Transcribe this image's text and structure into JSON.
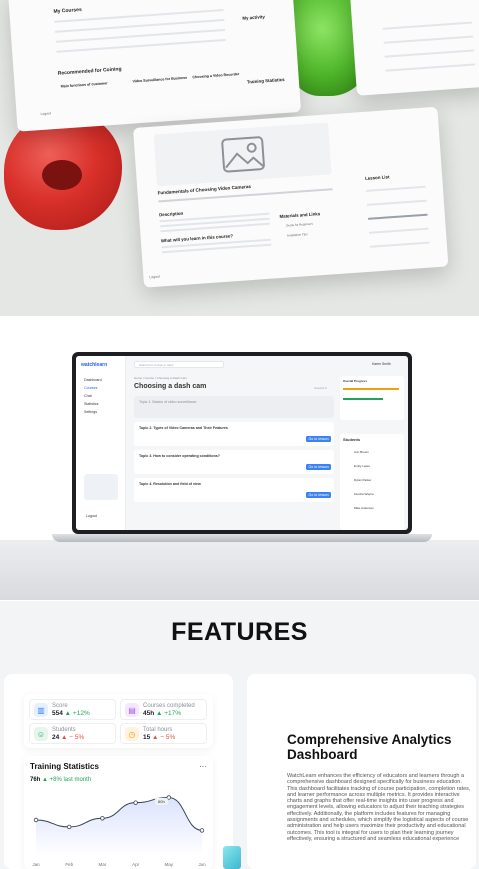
{
  "hero": {
    "dashboard_panel": {
      "my_courses": "My Courses",
      "recommended": "Recommended for Coining",
      "my_activity": "My activity",
      "training_stats": "Training Statistics",
      "course_cards": [
        "Main functions of customer",
        "Video Surveillance for Business",
        "Choosing a Video Recorder"
      ],
      "logout": "Logout"
    },
    "course_panel": {
      "video_title": "Fundamentals of Choosing Video Cameras",
      "description_heading": "Description",
      "learn_heading": "What will you learn in this course?",
      "materials_heading": "Materials and Links",
      "materials": [
        "Guide for Beginners",
        "Installation Tips"
      ],
      "lesson_list": "Lesson List",
      "logout": "Logout"
    }
  },
  "laptop": {
    "logo": "watchlearn",
    "search_placeholder": "Search for course or topic",
    "user_name": "Karen Smith",
    "breadcrumb": "Home / Course / Choosing a Dash Cam",
    "page_title": "Choosing a dash cam",
    "topic_count": "3 out of 4",
    "nav": [
      "Dashboard",
      "Courses",
      "Chat",
      "Statistics",
      "Settings"
    ],
    "topics": [
      {
        "title": "Topic 1. Basics of video surveillance",
        "status": ""
      },
      {
        "title": "Topic 2. Types of Video Cameras and Their Features",
        "status": "Go to lesson"
      },
      {
        "title": "Topic 3. How to consider operating conditions?",
        "status": "Go to lesson"
      },
      {
        "title": "Topic 4. Resolution and field of view",
        "status": "Go to lesson"
      }
    ],
    "progress_heading": "Overall Progress",
    "students_heading": "Students",
    "students": [
      "Ann Brown",
      "Emily Lewis",
      "Dylan Parker",
      "Kendra Wayne",
      "Mike Anderson"
    ],
    "logout": "Logout"
  },
  "features": {
    "title": "FEATURES",
    "stats": [
      {
        "label": "Score",
        "value": "554",
        "delta": "+12%",
        "trend": "up",
        "icon": "chart-icon",
        "color": "#3b82f6"
      },
      {
        "label": "Courses completed",
        "value": "45h",
        "delta": "+17%",
        "trend": "up",
        "icon": "book-icon",
        "color": "#a855f7"
      },
      {
        "label": "Students",
        "value": "24",
        "delta": "− 5%",
        "trend": "down",
        "icon": "user-icon",
        "color": "#22a35a"
      },
      {
        "label": "Total hours",
        "value": "15",
        "delta": "− 5%",
        "trend": "down",
        "icon": "clock-icon",
        "color": "#f59e0b"
      }
    ],
    "training": {
      "title": "Training Statistics",
      "menu": "···",
      "summary_value": "76h",
      "summary_delta": "+8% last month",
      "tooltip": "60h"
    },
    "chart_data": {
      "type": "line",
      "categories": [
        "Jan",
        "Feb",
        "Mar",
        "Apr",
        "May",
        "Jun"
      ],
      "series": [
        {
          "values": [
            30,
            22,
            32,
            50,
            56,
            18
          ]
        }
      ],
      "xlabel": "",
      "ylabel": "",
      "grid": false
    },
    "heading": "Comprehensive Analytics Dashboard",
    "body": "WatchLearn enhances the efficiency of educators and learners through a comprehensive dashboard designed specifically for business education. This dashboard facilitates tracking of course participation, completion rates, and learner performance across multiple metrics. It provides interactive charts and graphs that offer real-time insights into user progress and engagement levels, allowing educators to adjust their teaching strategies effectively. Additionally, the platform includes features for managing assignments and schedules, which simplify the logistical aspects of course administration and help users maximize their productivity and educational outcomes. This tool is integral for users to plan their learning journey effectively, ensuring a structured and seamless educational experience"
  }
}
